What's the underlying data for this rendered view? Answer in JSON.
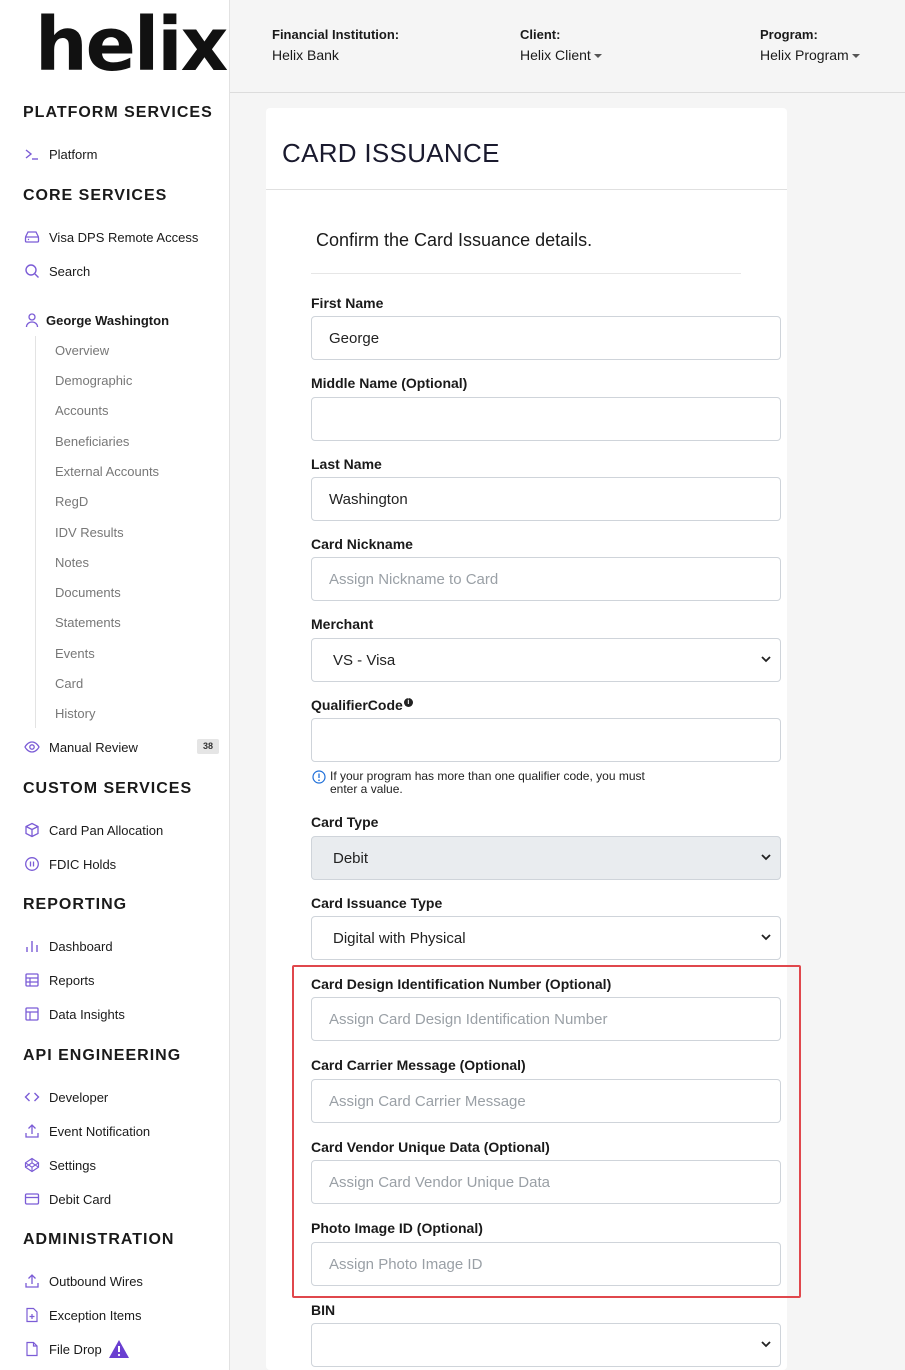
{
  "logo": "helix",
  "header": {
    "fi_label": "Financial Institution:",
    "fi_value": "Helix Bank",
    "client_label": "Client:",
    "client_value": "Helix Client",
    "program_label": "Program:",
    "program_value": "Helix Program"
  },
  "sidebar": {
    "platform_services": "PLATFORM SERVICES",
    "platform": "Platform",
    "core_services": "CORE SERVICES",
    "visa_dps": "Visa DPS Remote Access",
    "search": "Search",
    "customer": "George Washington",
    "sub_items": [
      "Overview",
      "Demographic",
      "Accounts",
      "Beneficiaries",
      "External Accounts",
      "RegD",
      "IDV Results",
      "Notes",
      "Documents",
      "Statements",
      "Events",
      "Card",
      "History"
    ],
    "manual_review": "Manual Review",
    "manual_review_count": "38",
    "custom_services": "CUSTOM SERVICES",
    "card_pan_allocation": "Card Pan Allocation",
    "fdic_holds": "FDIC Holds",
    "reporting": "REPORTING",
    "dashboard": "Dashboard",
    "reports": "Reports",
    "data_insights": "Data Insights",
    "api_engineering": "API ENGINEERING",
    "developer": "Developer",
    "event_notification": "Event Notification",
    "settings": "Settings",
    "debit_card": "Debit Card",
    "administration": "ADMINISTRATION",
    "outbound_wires": "Outbound Wires",
    "exception_items": "Exception Items",
    "file_drop": "File Drop"
  },
  "main": {
    "title": "CARD ISSUANCE",
    "confirm_text": "Confirm the Card Issuance details.",
    "fields": {
      "first_name_label": "First Name",
      "first_name_value": "George",
      "middle_name_label": "Middle Name (Optional)",
      "middle_name_value": "",
      "last_name_label": "Last Name",
      "last_name_value": "Washington",
      "nickname_label": "Card Nickname",
      "nickname_placeholder": "Assign Nickname to Card",
      "merchant_label": "Merchant",
      "merchant_value": "VS - Visa",
      "qualifier_label": "QualifierCode",
      "qualifier_value": "",
      "qualifier_hint_line1": "If your program has more than one qualifier code, you must",
      "qualifier_hint_line2": "enter a value.",
      "card_type_label": "Card Type",
      "card_type_value": "Debit",
      "issuance_type_label": "Card Issuance Type",
      "issuance_type_value": "Digital with Physical",
      "design_id_label": "Card Design Identification Number (Optional)",
      "design_id_placeholder": "Assign Card Design Identification Number",
      "carrier_msg_label": "Card Carrier Message (Optional)",
      "carrier_msg_placeholder": "Assign Card Carrier Message",
      "vendor_data_label": "Card Vendor Unique Data (Optional)",
      "vendor_data_placeholder": "Assign Card Vendor Unique Data",
      "photo_id_label": "Photo Image ID (Optional)",
      "photo_id_placeholder": "Assign Photo Image ID",
      "bin_label": "BIN",
      "bin_value": ""
    }
  },
  "colors": {
    "accent": "#7b5cd6",
    "highlight": "#e0474c",
    "warning": "#6a3fd1"
  }
}
